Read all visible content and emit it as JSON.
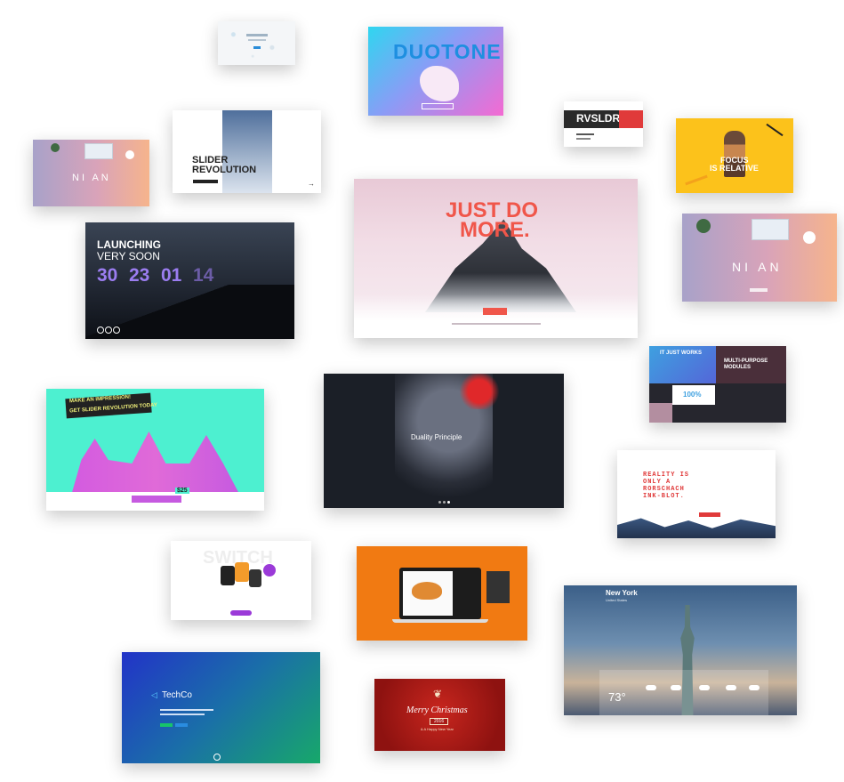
{
  "templates": {
    "duotone": {
      "title": "DUOTONE"
    },
    "slider_revolution": {
      "title_line1": "SLIDER",
      "title_line2": "REVOLUTION"
    },
    "nian": {
      "title": "NI AN"
    },
    "nian2": {
      "title": "NI AN"
    },
    "focus": {
      "title_line1": "FOCUS",
      "title_line2": "IS RELATIVE"
    },
    "launching": {
      "title_line1": "LAUNCHING",
      "title_line2": "VERY SOON",
      "countdown": [
        "30",
        "23",
        "01",
        "14"
      ]
    },
    "just_do_more": {
      "title_line1": "JUST DO",
      "title_line2": "MORE."
    },
    "it_just_works": {
      "title_left": "IT JUST WORKS",
      "title_right_line1": "MULTI-PURPOSE",
      "title_right_line2": "MODULES",
      "percent": "100%"
    },
    "impression": {
      "line1": "MAKE AN IMPRESSION!",
      "line2": "GET SLIDER REVOLUTION TODAY",
      "price": "$25"
    },
    "duality": {
      "title": "Duality Principle"
    },
    "reality": {
      "line1": "REALITY IS",
      "line2": "ONLY A",
      "line3": "RORSCHACH",
      "line4": "INK-BLOT."
    },
    "new_york": {
      "city": "New York",
      "country": "United States",
      "temperature": "73°"
    },
    "techco": {
      "brand": "TechCo"
    },
    "christmas": {
      "line1": "Merry Christmas",
      "year": "2016",
      "line2": "& A Happy New Year"
    }
  }
}
